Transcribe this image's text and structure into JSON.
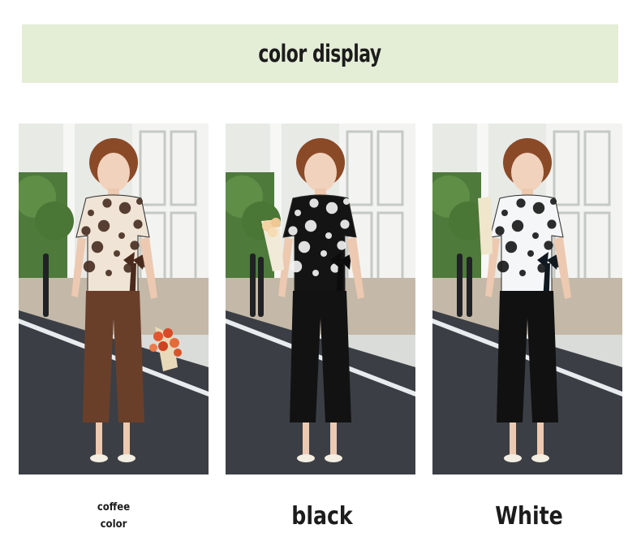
{
  "banner": {
    "title": "color display"
  },
  "variants": [
    {
      "caption_line1": "coffee",
      "caption_line2": "color",
      "image": "woman-coffee-outfit",
      "top_color": "#efe4d6",
      "dot_color": "#4a3024",
      "pants_color": "#6a3f2a",
      "bow_color": "#4a2a1c"
    },
    {
      "caption": "black",
      "image": "woman-black-outfit",
      "top_color": "#141414",
      "dot_color": "#f2f2f2",
      "pants_color": "#121212",
      "bow_color": "#0c0c0c"
    },
    {
      "caption": "White",
      "image": "woman-white-outfit",
      "top_color": "#f4f6f8",
      "dot_color": "#1a1a1a",
      "pants_color": "#111111",
      "bow_color": "#101820"
    }
  ]
}
